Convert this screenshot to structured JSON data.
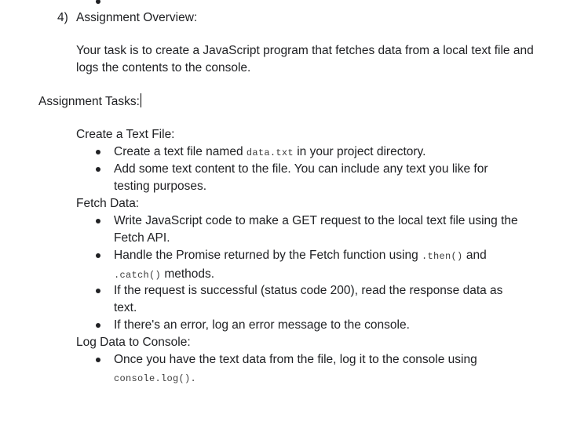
{
  "section": {
    "number": "4)",
    "title": "Assignment Overview:",
    "description": "Your task is to create a JavaScript program that fetches data from a local text file and logs the contents to the console."
  },
  "tasks_heading": "Assignment Tasks:",
  "groups": [
    {
      "heading": "Create a Text File:",
      "items": [
        {
          "pre": "Create a text file named ",
          "code": "data.txt",
          "post": " in your project directory."
        },
        {
          "text": "Add some text content to the file. You can include any text you like for testing purposes."
        }
      ]
    },
    {
      "heading": "Fetch Data:",
      "items": [
        {
          "text": "Write JavaScript code to make a GET request to the local text file using the Fetch API."
        },
        {
          "pre": "Handle the Promise returned by the Fetch function using ",
          "code": ".then()",
          "mid": " and",
          "code2": ".catch()",
          "post": " methods."
        },
        {
          "text": "If the request is successful (status code 200), read the response data as text."
        },
        {
          "text": "If there's an error, log an error message to the console."
        }
      ]
    },
    {
      "heading": "Log Data to Console:",
      "items": [
        {
          "pre": "Once you have the text data from the file, log it to the console using",
          "code": "console.log()",
          "post": "."
        }
      ]
    }
  ]
}
